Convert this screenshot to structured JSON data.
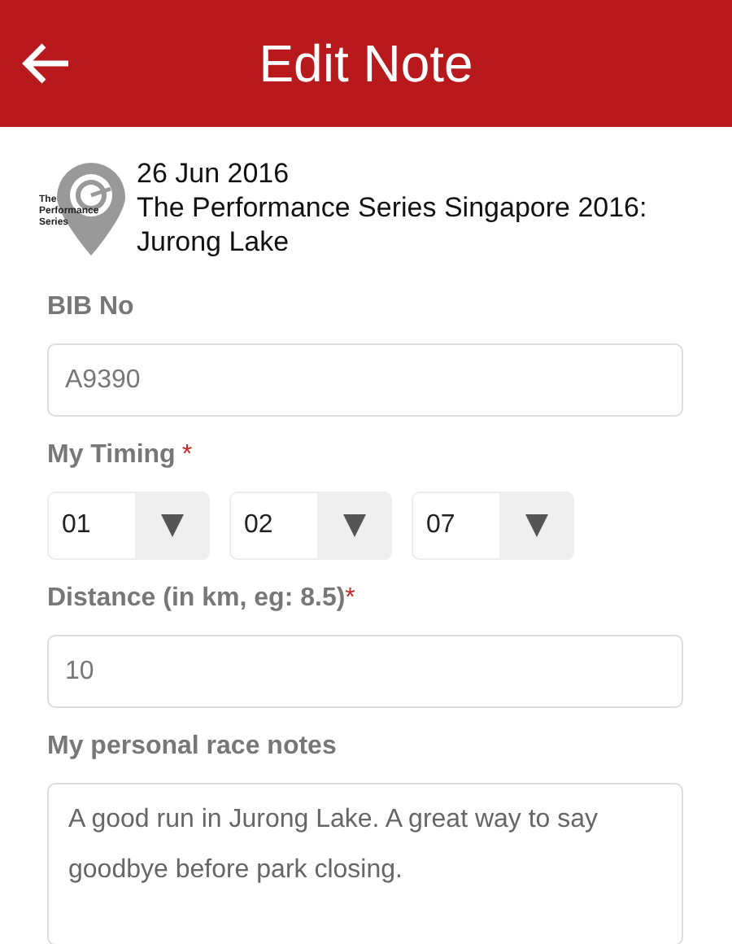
{
  "header": {
    "title": "Edit Note"
  },
  "event": {
    "logo_lines": [
      "The",
      "Performance",
      "Series"
    ],
    "date": "26 Jun 2016",
    "name": "The Performance Series Singapore 2016: Jurong Lake"
  },
  "fields": [
    {
      "kind": "text",
      "label": "BIB No",
      "value": "A9390"
    },
    {
      "kind": "timing",
      "label": "My Timing",
      "required_mark": "*",
      "selects": [
        "01",
        "02",
        "07"
      ]
    },
    {
      "kind": "text",
      "label": "Distance (in km, eg: 8.5)",
      "required_mark": "*",
      "value": "10"
    },
    {
      "kind": "textarea",
      "label": "My personal race notes",
      "value": "A good run in Jurong Lake. A great way to say goodbye before park closing."
    }
  ]
}
